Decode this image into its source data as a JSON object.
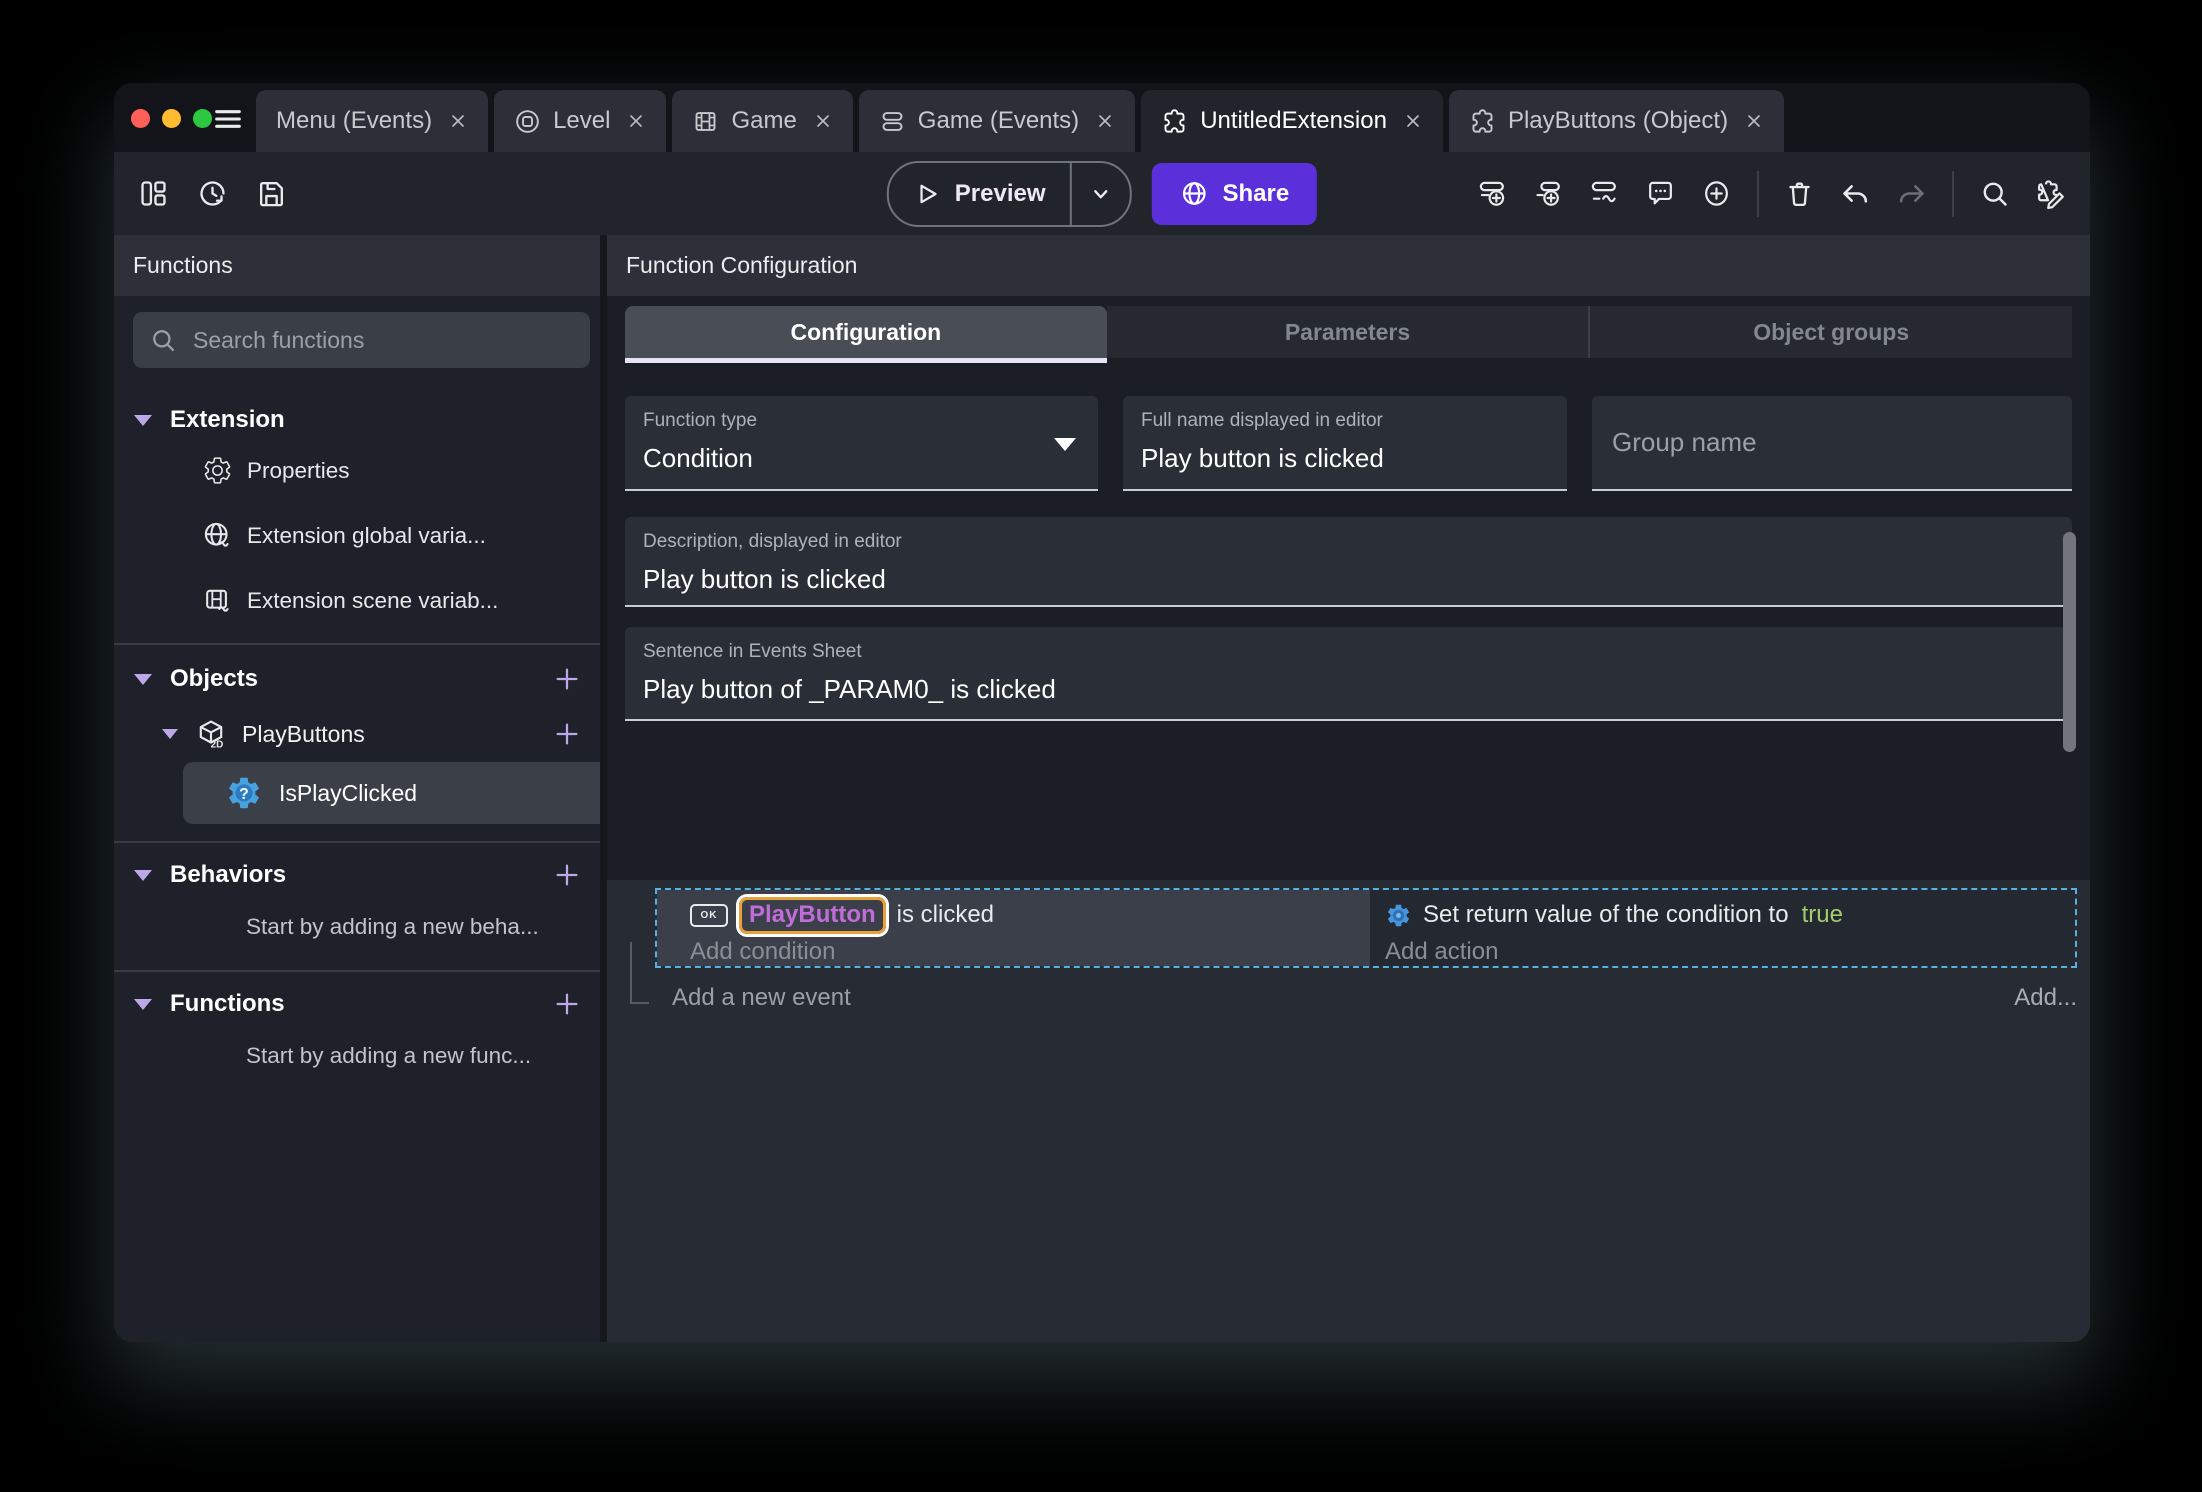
{
  "colors": {
    "accent_purple": "#5B30DB",
    "object_name_purple": "#C06CD9",
    "selection_orange": "#E8A13C",
    "true_green": "#A3CC6C",
    "selected_event_blue": "#55B1E0",
    "lavender_accent": "#BCA8E8"
  },
  "icons": {
    "function_badge": "?",
    "object_type_badge": "2D"
  },
  "titlebar": {
    "tabs": [
      {
        "label": "Menu (Events)"
      },
      {
        "label": "Level"
      },
      {
        "label": "Game"
      },
      {
        "label": "Game (Events)"
      },
      {
        "label": "UntitledExtension"
      },
      {
        "label": "PlayButtons (Object)"
      }
    ]
  },
  "toolbar": {
    "preview_label": "Preview",
    "share_label": "Share"
  },
  "sidebar": {
    "header": "Functions",
    "search_placeholder": "Search functions",
    "extension_section": {
      "label": "Extension",
      "items": [
        {
          "label": "Properties"
        },
        {
          "label": "Extension global varia..."
        },
        {
          "label": "Extension scene variab..."
        }
      ]
    },
    "objects_section": {
      "label": "Objects",
      "object_label": "PlayButtons",
      "function_label": "IsPlayClicked"
    },
    "behaviors_section": {
      "label": "Behaviors",
      "empty_text": "Start by adding a new beha..."
    },
    "functions_section": {
      "label": "Functions",
      "empty_text": "Start by adding a new func..."
    }
  },
  "main": {
    "header": "Function Configuration",
    "tabs": [
      {
        "label": "Configuration"
      },
      {
        "label": "Parameters"
      },
      {
        "label": "Object groups"
      }
    ],
    "fields": {
      "function_type": {
        "label": "Function type",
        "value": "Condition"
      },
      "full_name": {
        "label": "Full name displayed in editor",
        "value": "Play button is clicked"
      },
      "group_name": {
        "placeholder": "Group name"
      },
      "description": {
        "label": "Description, displayed in editor",
        "value": "Play button is clicked"
      },
      "sentence": {
        "label": "Sentence in Events Sheet",
        "value": "Play button of _PARAM0_ is clicked"
      }
    },
    "events": {
      "condition": {
        "badge": "OK",
        "object_name": "PlayButton",
        "text": "is clicked",
        "add_label": "Add condition"
      },
      "action": {
        "text": "Set return value of the condition to",
        "value": "true",
        "add_label": "Add action"
      },
      "footer": {
        "add_event_label": "Add a new event",
        "add_more_label": "Add..."
      }
    }
  }
}
